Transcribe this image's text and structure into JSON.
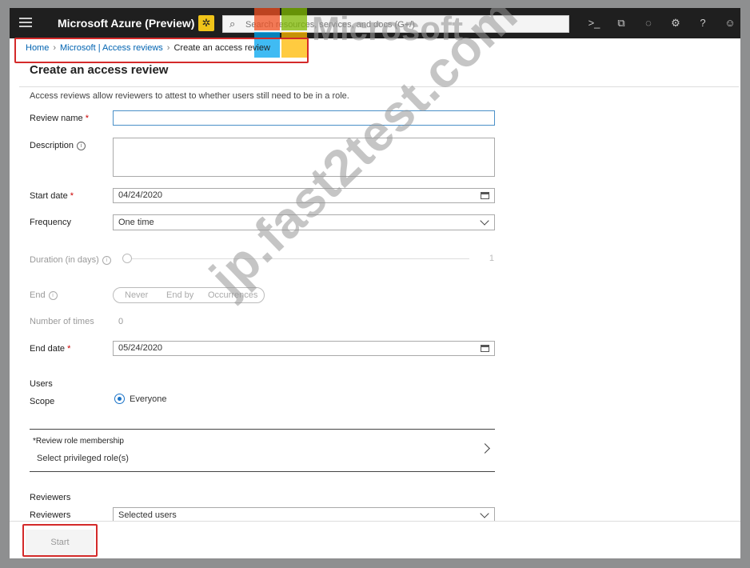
{
  "topbar": {
    "app_title": "Microsoft Azure (Preview)",
    "search_placeholder": "Search resources, services, and docs (G+/)"
  },
  "watermarks": {
    "microsoft": "Microsoft",
    "site": "jp.fast2test.com"
  },
  "breadcrumb": {
    "items": [
      "Home",
      "Microsoft | Access reviews",
      "Create an access review"
    ]
  },
  "page": {
    "title": "Create an access review",
    "intro": "Access reviews allow reviewers to attest to whether users still need to be in a role."
  },
  "form": {
    "review_name": {
      "label": "Review name",
      "required": "*",
      "value": ""
    },
    "description": {
      "label": "Description",
      "value": ""
    },
    "start_date": {
      "label": "Start date",
      "required": "*",
      "value": "04/24/2020"
    },
    "frequency": {
      "label": "Frequency",
      "value": "One time"
    },
    "duration": {
      "label": "Duration (in days)",
      "value": "1"
    },
    "end": {
      "label": "End",
      "options": [
        "Never",
        "End by",
        "Occurrences"
      ]
    },
    "number_of_times": {
      "label": "Number of times",
      "value": "0"
    },
    "end_date": {
      "label": "End date",
      "required": "*",
      "value": "05/24/2020"
    },
    "users": {
      "section": "Users",
      "scope_label": "Scope",
      "scope_value": "Everyone"
    },
    "role_membership": {
      "title": "*Review role membership",
      "value": "Select privileged role(s)"
    },
    "reviewers": {
      "section": "Reviewers",
      "label": "Reviewers",
      "value": "Selected users"
    }
  },
  "footer": {
    "start_label": "Start"
  },
  "colors": {
    "highlight": "#d42a2a",
    "link": "#0063b1",
    "preview_badge": "#f0c419"
  }
}
